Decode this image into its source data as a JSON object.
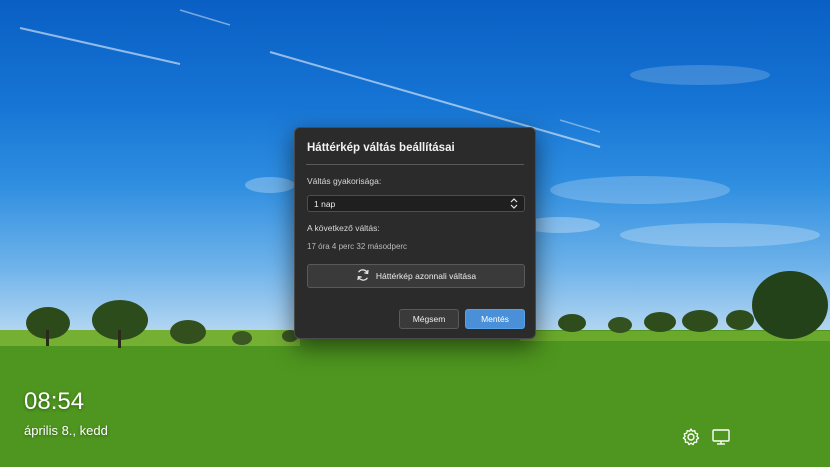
{
  "dialog": {
    "title": "Háttérkép váltás beállításai",
    "frequency_label": "Váltás gyakorisága:",
    "frequency_value": "1 nap",
    "next_label": "A következő váltás:",
    "next_value": "17 óra 4 perc 32 másodperc",
    "switch_now_label": "Háttérkép azonnali váltása",
    "cancel_label": "Mégsem",
    "save_label": "Mentés"
  },
  "lockscreen": {
    "time": "08:54",
    "date": "április 8., kedd"
  },
  "icons": {
    "refresh": "refresh-icon",
    "settings": "gear-icon",
    "display": "monitor-icon",
    "dropdown": "chevron-updown-icon"
  },
  "colors": {
    "accent": "#4a90d9",
    "dialog_bg": "#2b2b2b"
  }
}
